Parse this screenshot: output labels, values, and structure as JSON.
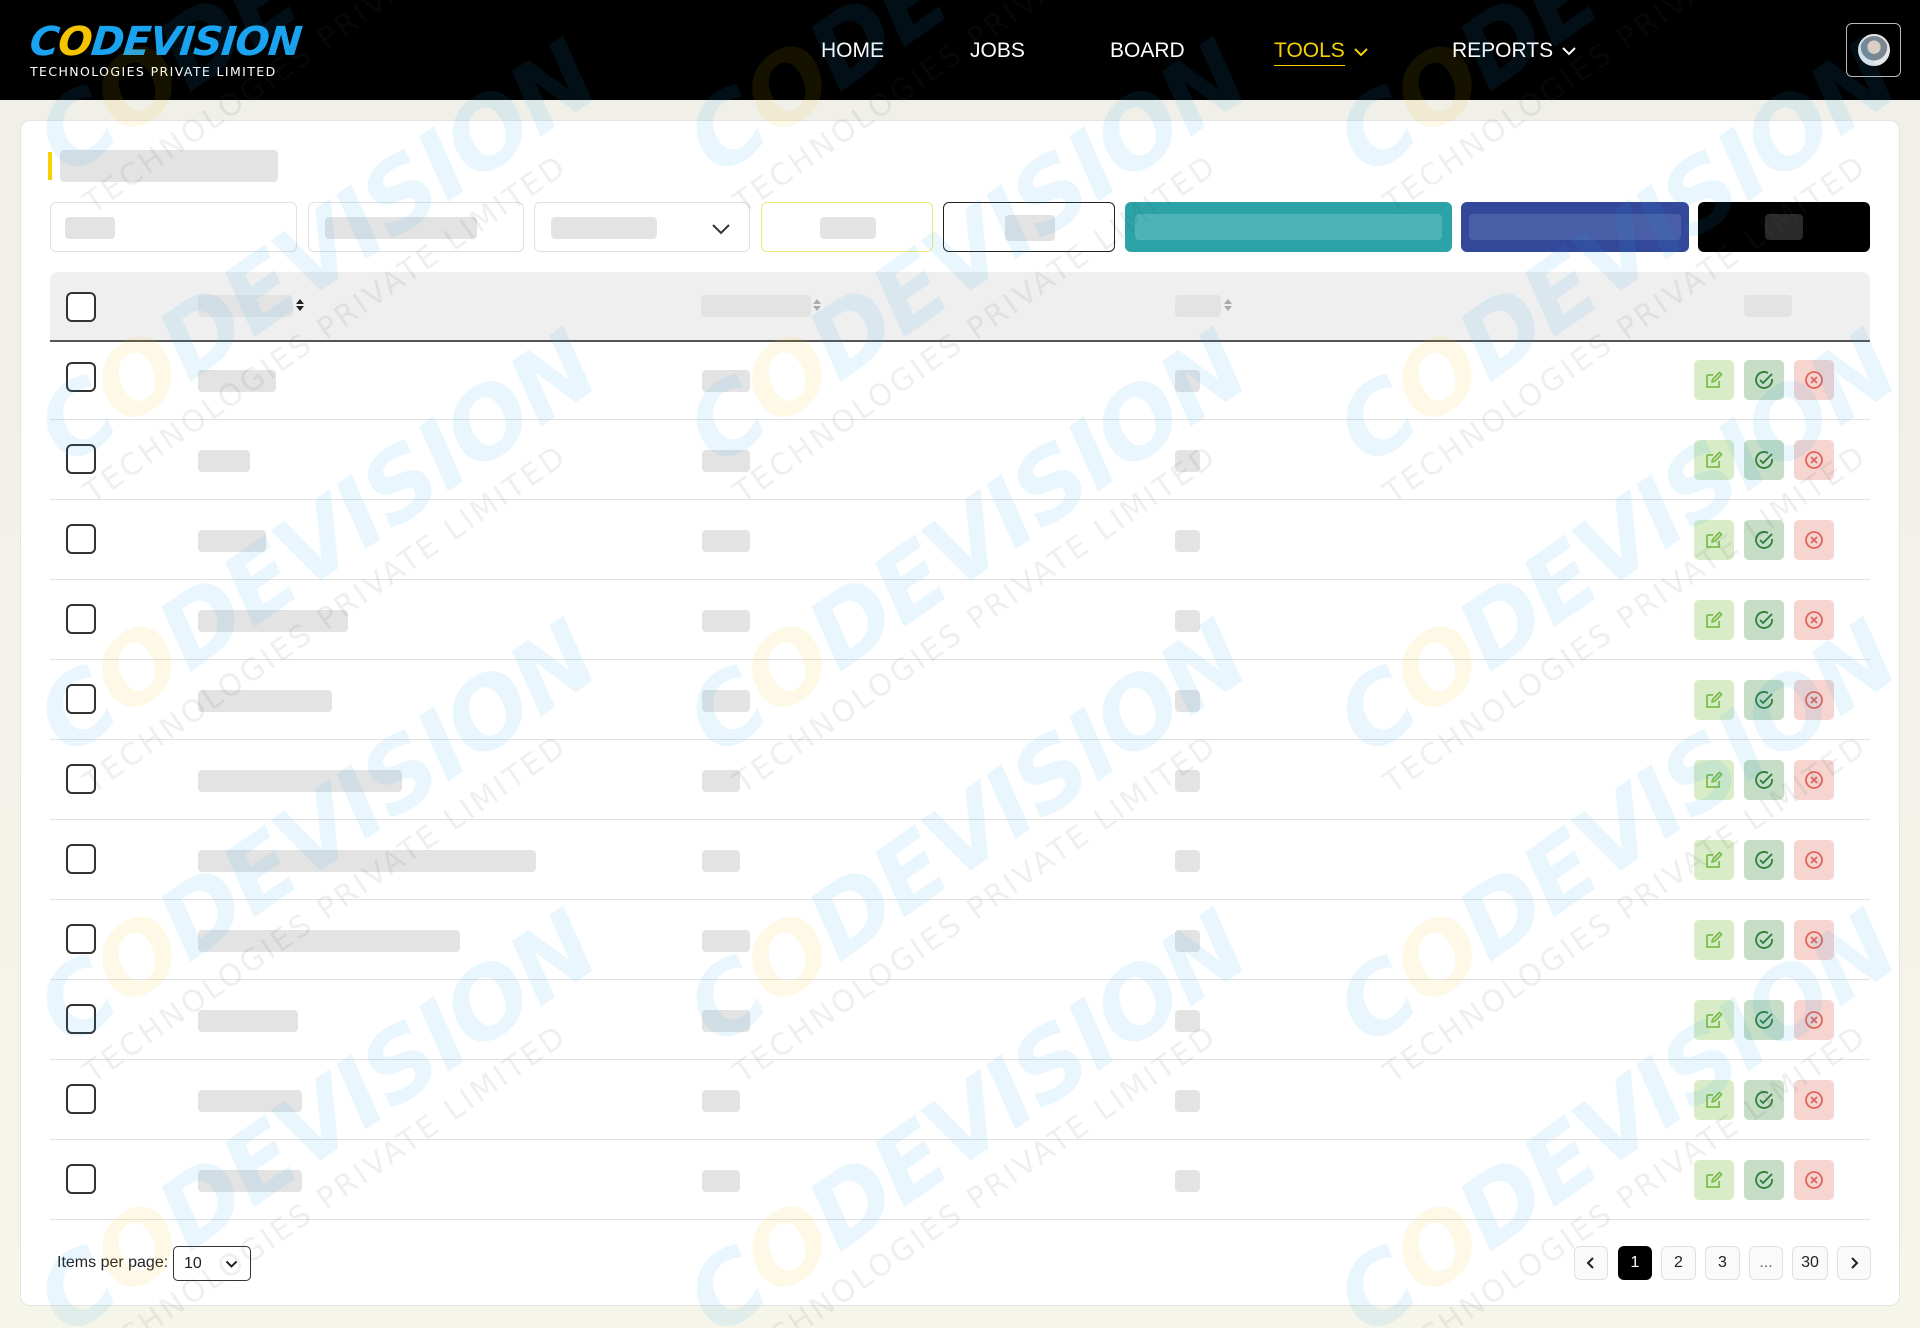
{
  "brand": {
    "logo_main_prefix": "C",
    "logo_main_o": "O",
    "logo_main_rest": "DEVISION",
    "logo_sub": "TECHNOLOGIES PRIVATE LIMITED"
  },
  "nav": {
    "items": [
      {
        "label": "HOME",
        "has_dropdown": false,
        "active": false
      },
      {
        "label": "JOBS",
        "has_dropdown": false,
        "active": false
      },
      {
        "label": "BOARD",
        "has_dropdown": false,
        "active": false
      },
      {
        "label": "TOOLS",
        "has_dropdown": true,
        "active": true
      },
      {
        "label": "REPORTS",
        "has_dropdown": true,
        "active": false
      }
    ]
  },
  "colors": {
    "accent_yellow": "#f5d200",
    "teal_button": "#2ba3a7",
    "navy_button": "#34489a",
    "black_button": "#000000",
    "edit_icon": "#7cbf4f",
    "approve_icon": "#2f7d3a",
    "reject_icon": "#e0645a"
  },
  "icons": {
    "sort": "sort-icon",
    "edit": "edit-icon",
    "approve": "check-circle-icon",
    "reject": "x-circle-icon",
    "dropdown": "chevron-down-icon",
    "prev": "chevron-left-icon",
    "next": "chevron-right-icon"
  },
  "table": {
    "row_count": 11,
    "loading": true
  },
  "pagination": {
    "items_per_page_label": "Items per page:",
    "items_per_page_value": "10",
    "pages": [
      "1",
      "2",
      "3",
      "...",
      "30"
    ],
    "current_page": "1"
  }
}
